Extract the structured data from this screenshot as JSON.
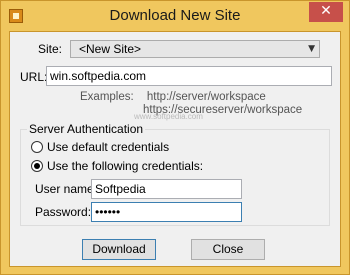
{
  "window": {
    "title": "Download New Site",
    "close_glyph": "✕"
  },
  "site": {
    "label": "Site:",
    "value": "<New Site>"
  },
  "url": {
    "label": "URL:",
    "value": "win.softpedia.com"
  },
  "examples": {
    "label": "Examples:",
    "lines": [
      "http://server/workspace",
      "https://secureserver/workspace"
    ]
  },
  "watermark": "www.softpedia.com",
  "auth": {
    "group_title": "Server Authentication",
    "default_label": "Use default credentials",
    "custom_label": "Use the following credentials:",
    "username_label": "User name:",
    "username_value": "Softpedia",
    "password_label": "Password:",
    "password_value": "••••••"
  },
  "buttons": {
    "download": "Download",
    "close": "Close"
  }
}
